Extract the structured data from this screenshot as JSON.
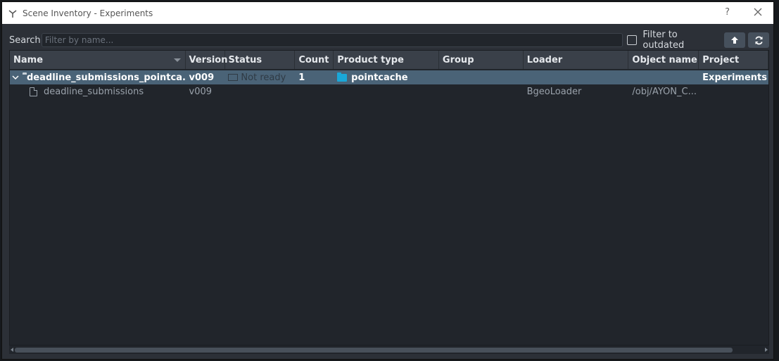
{
  "window": {
    "title": "Scene Inventory - Experiments",
    "help": "?"
  },
  "search": {
    "label": "Search",
    "placeholder": "Filter by name...",
    "filter_outdated_label": "Filter to outdated"
  },
  "columns": [
    "Name",
    "Version",
    "Status",
    "Count",
    "Product type",
    "Group",
    "Loader",
    "Object name",
    "Project"
  ],
  "rows": [
    {
      "name": "deadline_submissions_pointca...",
      "version": "v009",
      "status": "Not ready",
      "count": "1",
      "product_type": "pointcache",
      "group": "",
      "loader": "",
      "object_name": "",
      "project": "Experiments"
    },
    {
      "name": "deadline_submissions",
      "version": "v009",
      "status": "",
      "count": "",
      "product_type": "",
      "group": "",
      "loader": "BgeoLoader",
      "object_name": "/obj/AYON_C...",
      "project": ""
    }
  ],
  "icons": {
    "app": "ayon-icon",
    "close": "close-icon",
    "refresh": "refresh-icon",
    "up": "arrow-up-icon",
    "folder": "folder-icon",
    "file": "file-icon"
  },
  "colors": {
    "selection": "#4a6377",
    "accent": "#1aa7d8",
    "header": "#3a4049"
  }
}
